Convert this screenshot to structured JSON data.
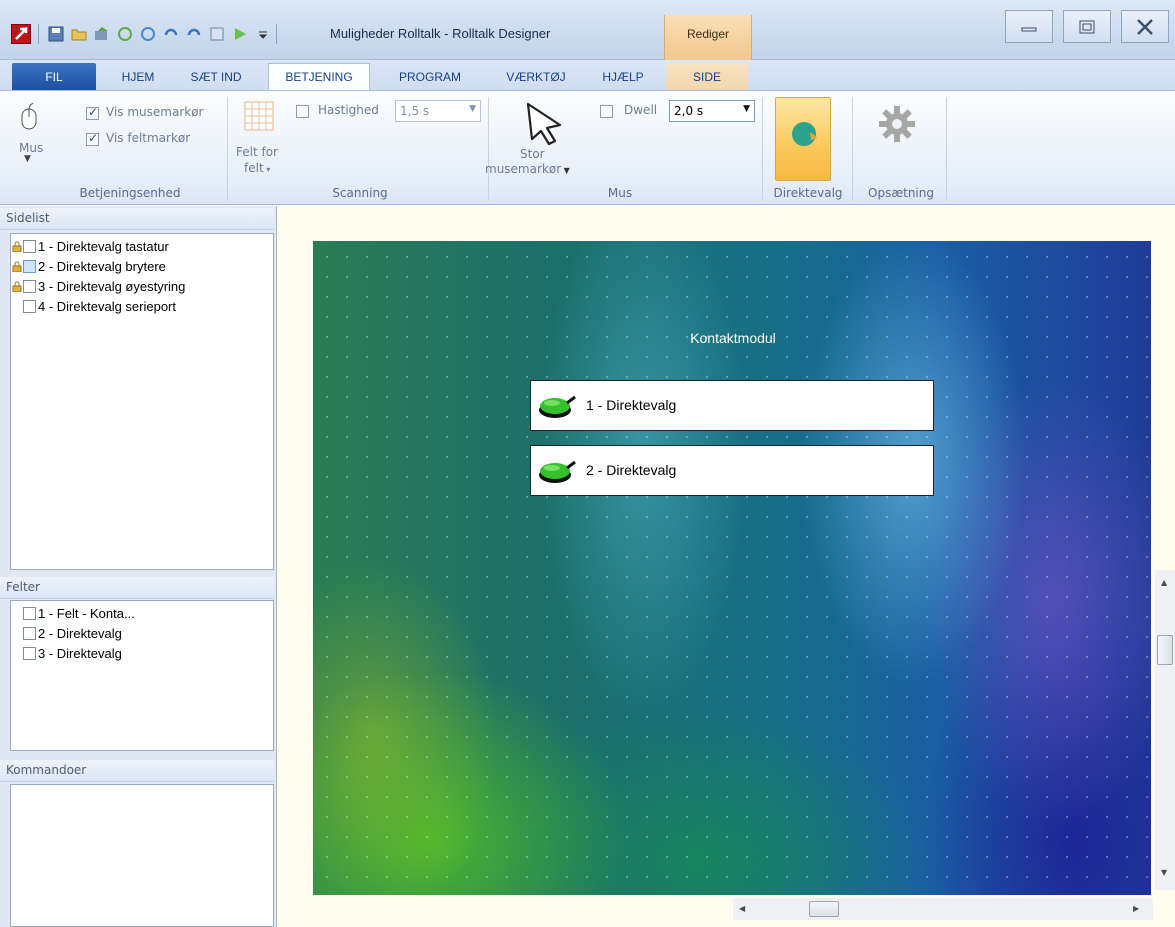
{
  "window": {
    "title": "Muligheder Rolltalk - Rolltalk Designer",
    "context_tab_group": "Rediger"
  },
  "tabs": [
    {
      "label": "FIL"
    },
    {
      "label": "HJEM"
    },
    {
      "label": "SÆT IND"
    },
    {
      "label": "BETJENING",
      "active": true
    },
    {
      "label": "PROGRAM"
    },
    {
      "label": "VÆRKTØJ"
    },
    {
      "label": "HJÆLP"
    },
    {
      "label": "SIDE"
    }
  ],
  "ribbon": {
    "betjeningsenhed": {
      "mus_label": "Mus",
      "vis_musemarkor": "Vis musemarkør",
      "vis_feltmarkor": "Vis feltmarkør",
      "group": "Betjeningsenhed"
    },
    "scanning": {
      "felt_for_felt_line1": "Felt for",
      "felt_for_felt_line2": "felt",
      "hastighed_label": "Hastighed",
      "hastighed_value": "1,5 s",
      "group": "Scanning"
    },
    "mus": {
      "stor_line1": "Stor",
      "stor_line2": "musemarkør",
      "dwell_label": "Dwell",
      "dwell_value": "2,0 s",
      "group": "Mus"
    },
    "direktevalg": {
      "group": "Direktevalg"
    },
    "opsaetning": {
      "group": "Opsætning"
    }
  },
  "sidelist": {
    "header": "Sidelist",
    "items": [
      {
        "label": "1 - Direktevalg tastatur",
        "locked": true
      },
      {
        "label": "2 - Direktevalg brytere",
        "locked": true,
        "selected": true
      },
      {
        "label": "3 - Direktevalg øyestyring",
        "locked": true
      },
      {
        "label": "4 - Direktevalg serieport",
        "locked": false
      }
    ]
  },
  "felter": {
    "header": "Felter",
    "items": [
      {
        "label": "1 - Felt - Konta..."
      },
      {
        "label": "2 - Direktevalg"
      },
      {
        "label": "3 - Direktevalg"
      }
    ]
  },
  "kommandoer": {
    "header": "Kommandoer"
  },
  "canvas": {
    "title": "Kontaktmodul",
    "fields": [
      {
        "label": "1 - Direktevalg"
      },
      {
        "label": "2 - Direktevalg"
      }
    ]
  },
  "colors": {
    "accent": "#1d4f9f",
    "ribbon_highlight": "#f9c95a",
    "canvas_bg": "#fffdf0",
    "switch_green": "#34c12b"
  }
}
